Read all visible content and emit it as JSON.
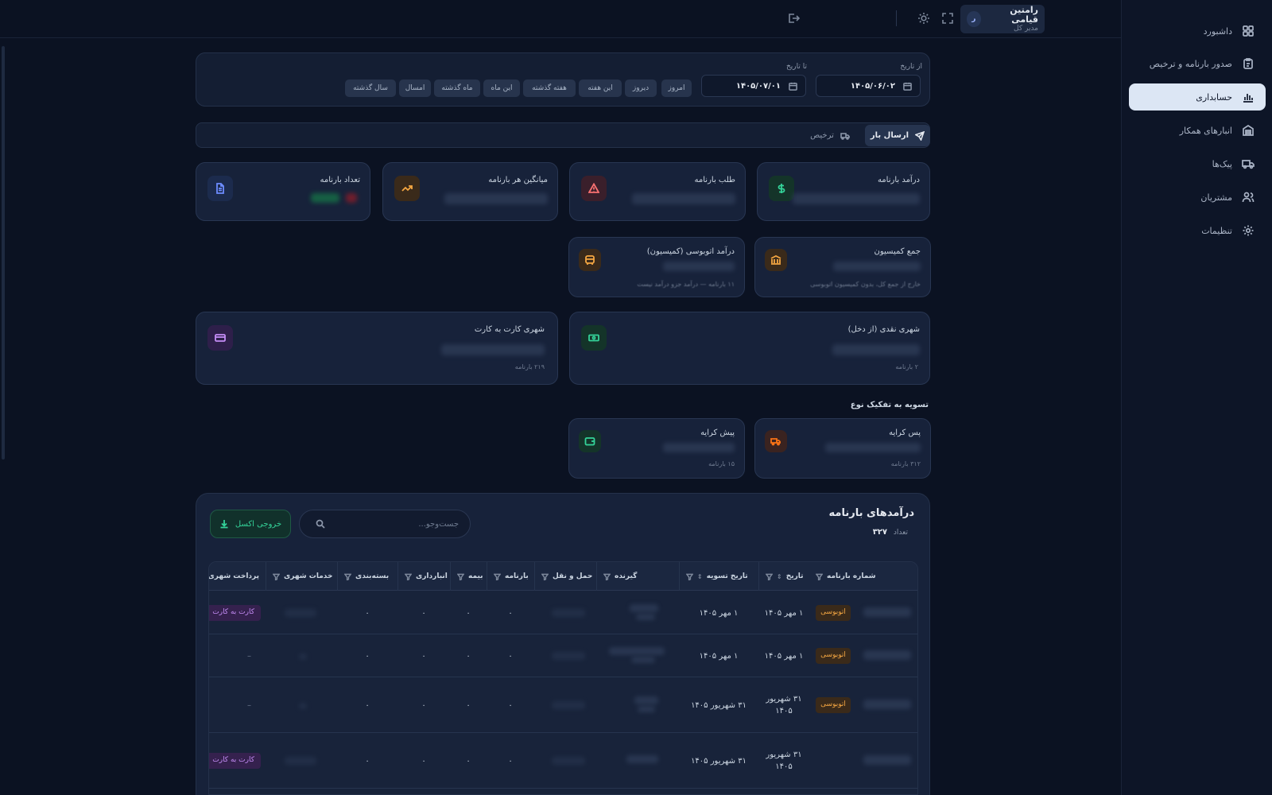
{
  "sidebar": {
    "items": [
      {
        "label": "داشبورد",
        "icon": "dashboard-grid-icon",
        "active": false
      },
      {
        "label": "صدور بارنامه و ترخیص",
        "icon": "clipboard-icon",
        "active": false
      },
      {
        "label": "حسابداری",
        "icon": "bar-chart-icon",
        "active": true
      },
      {
        "label": "انبارهای همکار",
        "icon": "warehouse-icon",
        "active": false
      },
      {
        "label": "پیک‌ها",
        "icon": "truck-icon",
        "active": false
      },
      {
        "label": "مشتریان",
        "icon": "users-icon",
        "active": false
      },
      {
        "label": "تنظیمات",
        "icon": "gear-icon",
        "active": false
      }
    ]
  },
  "header": {
    "user_name": "رامتین قیامی",
    "user_role": "مدیر کل",
    "avatar_letter": "ر"
  },
  "filters": {
    "from_label": "از تاریخ",
    "from_value": "۱۴۰۵/۰۶/۰۲",
    "to_label": "تا تاریخ",
    "to_value": "۱۴۰۵/۰۷/۰۱",
    "presets": [
      "امروز",
      "دیروز",
      "این هفته",
      "هفته گذشته",
      "این ماه",
      "ماه گذشته",
      "امسال",
      "سال گذشته"
    ]
  },
  "tabs": {
    "active": "ارسال بار",
    "inactive": "ترخیص"
  },
  "stats": {
    "revenue_title": "درآمد بارنامه",
    "debt_title": "طلب بارنامه",
    "avg_title": "میانگین هر بارنامه",
    "count_title": "تعداد بارنامه",
    "commission_title": "جمع کمیسیون",
    "commission_sub": "خارج از جمع کل، بدون کمیسیون اتوبوسی",
    "bus_title": "درآمد اتوبوسی (کمیسیون)",
    "bus_sub": "۱۱ بارنامه — درآمد جزو درآمد نیست",
    "cash_title": "شهری نقدی (از دخل)",
    "cash_sub": "۲ بارنامه",
    "card_title": "شهری کارت به کارت",
    "card_sub": "۲۱۹ بارنامه"
  },
  "settlement": {
    "section_title": "تسویه به تفکیک نوع",
    "postpaid_title": "پس کرایه",
    "postpaid_sub": "۳۱۲ بارنامه",
    "prepaid_title": "پیش کرایه",
    "prepaid_sub": "۱۵ بارنامه"
  },
  "table_panel": {
    "title": "درآمدهای بارنامه",
    "count_label": "تعداد",
    "count_value": "۳۲۷",
    "search_placeholder": "جست‌وجو...",
    "export_label": "خروجی اکسل"
  },
  "table": {
    "columns": [
      "شماره بارنامه",
      "تاریخ",
      "تاریخ تسویه",
      "گیرنده",
      "حمل و نقل",
      "بارنامه",
      "بیمه",
      "انبارداری",
      "بسته‌بندی",
      "خدمات شهری",
      "پرداخت شهری"
    ],
    "rows": [
      {
        "type": "اتوبوسی",
        "date": "۱ مهر ۱۴۰۵",
        "settle": "۱ مهر ۱۴۰۵",
        "bar": "۰",
        "bime": "۰",
        "anbar": "۰",
        "baste": "۰",
        "pay": "کارت به کارت"
      },
      {
        "type": "اتوبوسی",
        "date": "۱ مهر ۱۴۰۵",
        "settle": "۱ مهر ۱۴۰۵",
        "bar": "۰",
        "bime": "۰",
        "anbar": "۰",
        "baste": "۰",
        "pay": "–"
      },
      {
        "type": "اتوبوسی",
        "date": "۳۱ شهریور ۱۴۰۵",
        "settle": "۳۱ شهریور ۱۴۰۵",
        "bar": "۰",
        "bime": "۰",
        "anbar": "۰",
        "baste": "۰",
        "pay": "–"
      },
      {
        "type": "",
        "date": "۳۱ شهریور ۱۴۰۵",
        "settle": "۳۱ شهریور ۱۴۰۵",
        "bar": "۰",
        "bime": "۰",
        "anbar": "۰",
        "baste": "۰",
        "pay": "کارت به کارت"
      }
    ]
  },
  "colors": {
    "background": "#0b1222",
    "accent_green": "#34d399",
    "badge_orange": "#f5a742",
    "badge_purple": "#c48cf5"
  }
}
